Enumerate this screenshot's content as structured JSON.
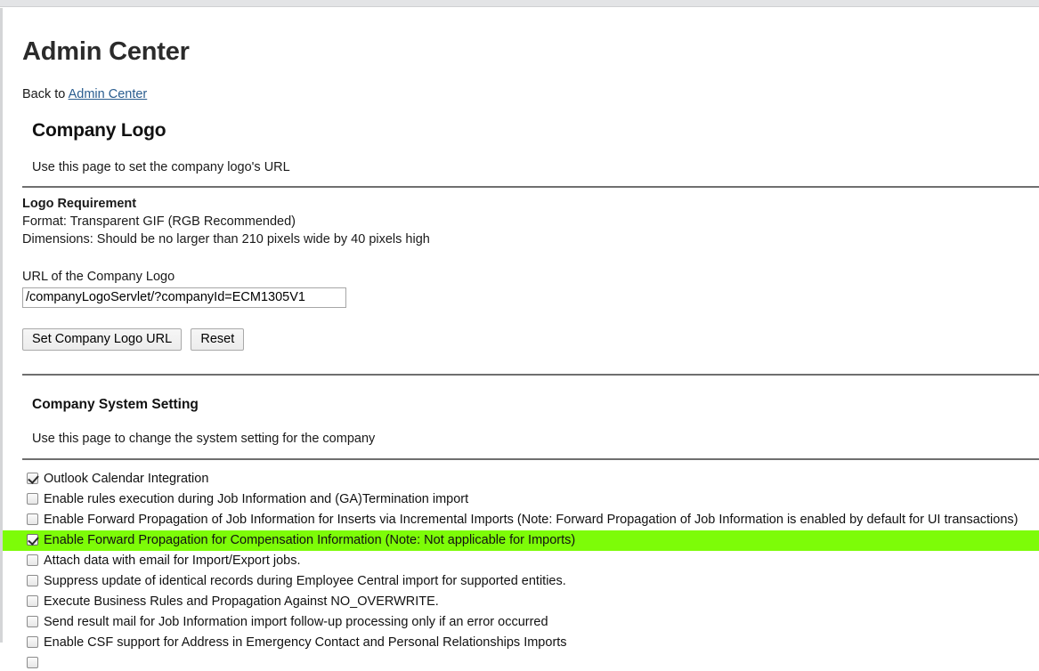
{
  "window": {
    "top_strip": true
  },
  "header": {
    "title": "Admin Center",
    "back_prefix": "Back to ",
    "back_link": "Admin Center"
  },
  "company_logo": {
    "section_title": "Company Logo",
    "subtitle": "Use this page to set the company logo's URL",
    "requirement_heading": "Logo Requirement",
    "requirement_format": "Format: Transparent GIF (RGB Recommended)",
    "requirement_dimensions": "Dimensions: Should be no larger than 210 pixels wide by 40 pixels high",
    "url_label": "URL of the Company Logo",
    "url_value": "/companyLogoServlet/?companyId=ECM1305V1",
    "url_placeholder": "",
    "set_button": "Set Company Logo URL",
    "reset_button": "Reset"
  },
  "company_system_setting": {
    "section_title": "Company System Setting",
    "subtitle": "Use this page to change the system setting for the company",
    "highlight_color": "#7dfc08",
    "options": [
      {
        "label": "Outlook Calendar Integration",
        "checked": true,
        "highlighted": false
      },
      {
        "label": "Enable rules execution during Job Information and (GA)Termination import",
        "checked": false,
        "highlighted": false
      },
      {
        "label": "Enable Forward Propagation of Job Information for Inserts via Incremental Imports (Note: Forward Propagation of Job Information is enabled by default for UI transactions)",
        "checked": false,
        "highlighted": false
      },
      {
        "label": "Enable Forward Propagation for Compensation Information (Note: Not applicable for Imports)",
        "checked": true,
        "highlighted": true
      },
      {
        "label": "Attach data with email for Import/Export jobs.",
        "checked": false,
        "highlighted": false
      },
      {
        "label": "Suppress update of identical records during Employee Central import for supported entities.",
        "checked": false,
        "highlighted": false
      },
      {
        "label": "Execute Business Rules and Propagation Against NO_OVERWRITE.",
        "checked": false,
        "highlighted": false
      },
      {
        "label": "Send result mail for Job Information import follow-up processing only if an error occurred",
        "checked": false,
        "highlighted": false
      },
      {
        "label": "Enable CSF support for Address in Emergency Contact and Personal Relationships Imports",
        "checked": false,
        "highlighted": false
      },
      {
        "label": "",
        "checked": false,
        "highlighted": false
      }
    ]
  }
}
